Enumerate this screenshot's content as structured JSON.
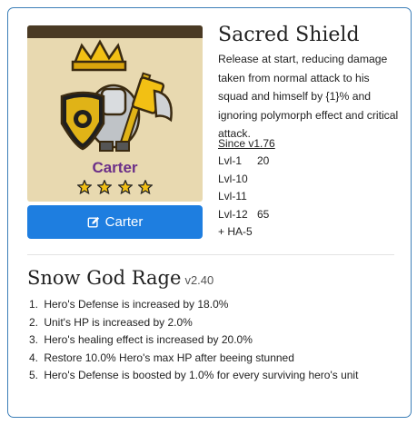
{
  "hero": {
    "name": "Carter",
    "stars": 4,
    "button_label": "Carter"
  },
  "skill": {
    "title": "Sacred Shield",
    "description": "Release at start, reducing damage taken from normal attack to his squad and himself by {1}% and ignoring polymorph effect and critical attack.",
    "since": "Since v1.76",
    "levels": [
      {
        "label": "Lvl-1",
        "value": "20"
      },
      {
        "label": "Lvl-10",
        "value": ""
      },
      {
        "label": "Lvl-11",
        "value": ""
      },
      {
        "label": "Lvl-12",
        "value": "65"
      },
      {
        "label": "+ HA-5",
        "value": ""
      }
    ]
  },
  "rage": {
    "title": "Snow God Rage",
    "version": "v2.40",
    "effects": [
      {
        "num": "1.",
        "text": "Hero's Defense is increased by 18.0%"
      },
      {
        "num": "2.",
        "text": "Unit's HP is increased by 2.0%"
      },
      {
        "num": "3.",
        "text": "Hero's healing effect is increased by 20.0%"
      },
      {
        "num": "4.",
        "text": "Restore 10.0% Hero's max HP after beeing stunned"
      },
      {
        "num": "5.",
        "text": "Hero's Defense is boosted by 1.0% for every surviving hero's unit"
      }
    ]
  },
  "colors": {
    "border": "#3d7fb8",
    "button": "#1e7ee0",
    "hero_name": "#6b2f88",
    "star": "#f2c014",
    "portrait_bg": "#e8d9b0"
  }
}
